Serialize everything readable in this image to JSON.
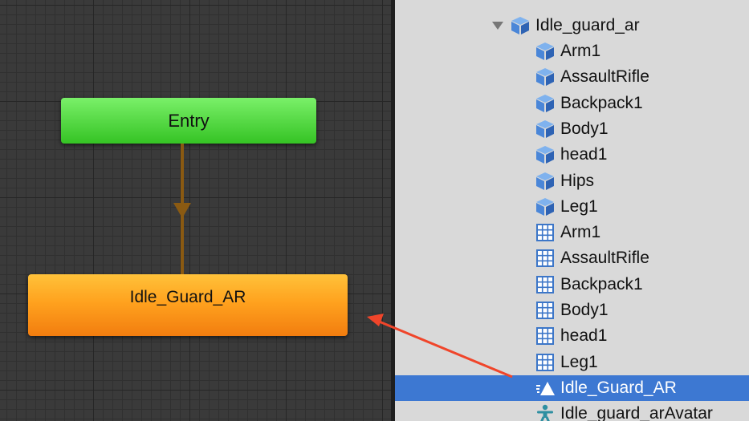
{
  "animator": {
    "entry_label": "Entry",
    "state_label": "Idle_Guard_AR"
  },
  "hierarchy": {
    "root": {
      "label": "Idle_guard_ar",
      "icon": "prefab-icon",
      "expanded": true
    },
    "items": [
      {
        "label": "Arm1",
        "icon": "prefab-icon"
      },
      {
        "label": "AssaultRifle",
        "icon": "prefab-icon"
      },
      {
        "label": "Backpack1",
        "icon": "prefab-icon"
      },
      {
        "label": "Body1",
        "icon": "prefab-icon"
      },
      {
        "label": "head1",
        "icon": "prefab-icon"
      },
      {
        "label": "Hips",
        "icon": "prefab-icon"
      },
      {
        "label": "Leg1",
        "icon": "prefab-icon"
      },
      {
        "label": "Arm1",
        "icon": "mesh-icon"
      },
      {
        "label": "AssaultRifle",
        "icon": "mesh-icon"
      },
      {
        "label": "Backpack1",
        "icon": "mesh-icon"
      },
      {
        "label": "Body1",
        "icon": "mesh-icon"
      },
      {
        "label": "head1",
        "icon": "mesh-icon"
      },
      {
        "label": "Leg1",
        "icon": "mesh-icon"
      },
      {
        "label": "Idle_Guard_AR",
        "icon": "animation-clip-icon",
        "selected": true
      },
      {
        "label": "Idle_guard_arAvatar",
        "icon": "avatar-icon"
      }
    ]
  },
  "colors": {
    "selection": "#3d78d2",
    "annotation_arrow": "#f0452a",
    "transition": "#8a5a12"
  }
}
